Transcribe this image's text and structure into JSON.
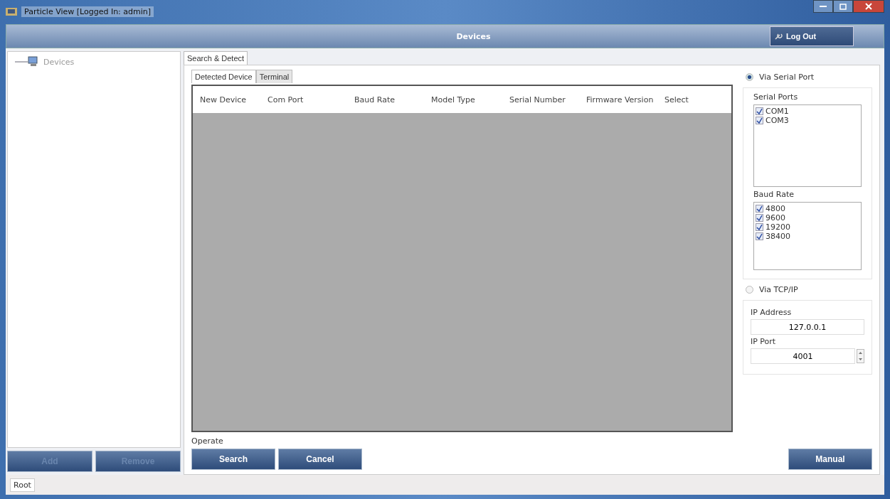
{
  "window": {
    "title": "Particle View [Logged In: admin]"
  },
  "header": {
    "title": "Devices",
    "logout": "Log Out"
  },
  "tree": [
    {
      "label": "Devices",
      "selected": false
    }
  ],
  "left_buttons": [
    {
      "label": "Add",
      "disabled": true
    },
    {
      "label": "Remove",
      "disabled": true
    }
  ],
  "outer_tabs": [
    {
      "label": "Search & Detect",
      "selected": true
    }
  ],
  "inner_tabs": [
    {
      "label": "Detected Device",
      "selected": true
    },
    {
      "label": "Terminal",
      "selected": false
    }
  ],
  "table": {
    "columns": [
      "New Device",
      "Com Port",
      "Baud Rate",
      "Model Type",
      "Serial Number",
      "Firmware Version",
      "Select"
    ]
  },
  "connection": [
    {
      "label": "Via Serial Port",
      "selected": true
    },
    {
      "label": "Via TCP/IP",
      "selected": false
    }
  ],
  "serial_ports": {
    "title": "Serial Ports",
    "items": [
      {
        "label": "COM1",
        "checked": true
      },
      {
        "label": "COM3",
        "checked": true
      }
    ]
  },
  "baud_rates": {
    "title": "Baud Rate",
    "items": [
      {
        "label": "4800",
        "checked": true
      },
      {
        "label": "9600",
        "checked": true
      },
      {
        "label": "19200",
        "checked": true
      },
      {
        "label": "38400",
        "checked": true
      }
    ]
  },
  "ip_address": {
    "label": "IP Address",
    "value": "127.0.0.1"
  },
  "ip_port": {
    "label": "IP Port",
    "value": "4001"
  },
  "operate": {
    "title": "Operate",
    "buttons": [
      "Search",
      "Cancel"
    ],
    "manual": "Manual"
  },
  "status_bar": {
    "text": "Root"
  }
}
